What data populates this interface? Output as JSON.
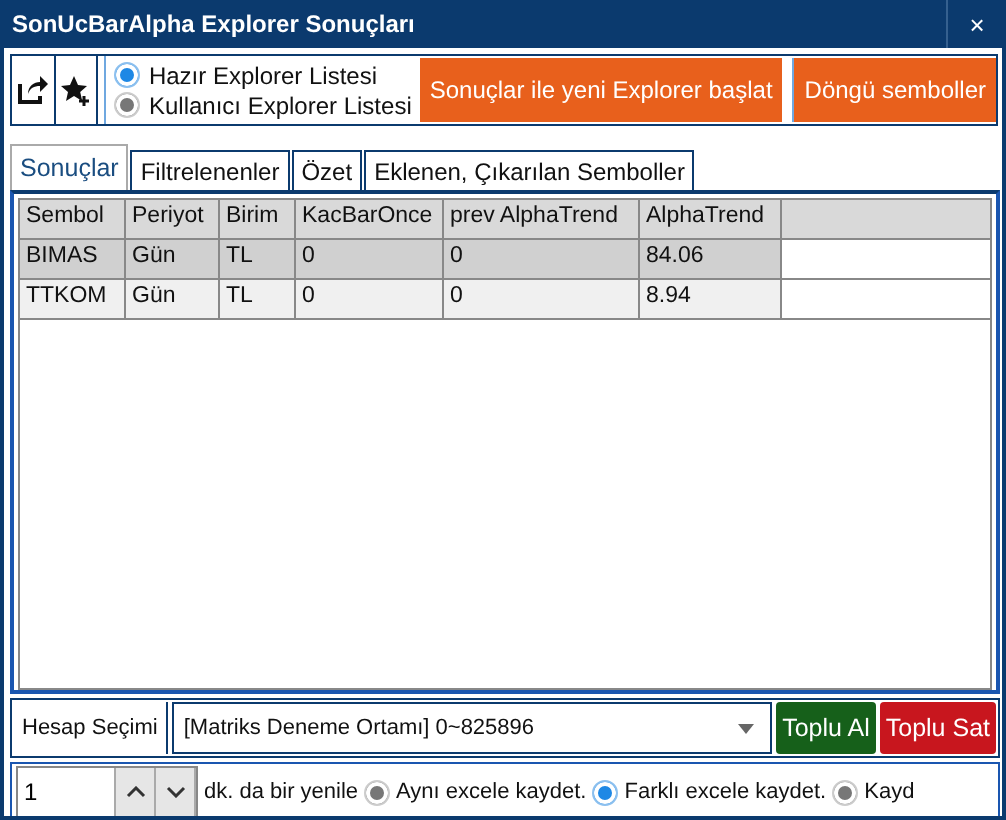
{
  "window": {
    "title": "SonUcBarAlpha Explorer Sonuçları",
    "close": "×"
  },
  "toolbar": {
    "list_options": [
      {
        "label": "Hazır Explorer Listesi",
        "selected": true
      },
      {
        "label": "Kullanıcı Explorer Listesi",
        "selected": false
      }
    ],
    "buttons": [
      "Sonuçlar ile yeni Explorer başlat",
      "Döngü semboller"
    ]
  },
  "tabs": [
    {
      "label": "Sonuçlar",
      "selected": true
    },
    {
      "label": "Filtrelenenler",
      "selected": false
    },
    {
      "label": "Özet",
      "selected": false
    },
    {
      "label": "Eklenen, Çıkarılan Semboller",
      "selected": false
    }
  ],
  "table": {
    "columns": [
      "Sembol",
      "Periyot",
      "Birim",
      "KacBarOnce",
      "prev AlphaTrend",
      "AlphaTrend"
    ],
    "rows": [
      {
        "cells": [
          "BIMAS",
          "Gün",
          "TL",
          "0",
          "0",
          "84.06"
        ],
        "selected": true
      },
      {
        "cells": [
          "TTKOM",
          "Gün",
          "TL",
          "0",
          "0",
          "8.94"
        ],
        "selected": false
      }
    ]
  },
  "account": {
    "label": "Hesap Seçimi",
    "value": "[Matriks Deneme Ortamı] 0~825896",
    "buy": "Toplu Al",
    "sell": "Toplu Sat"
  },
  "refresh": {
    "value": "1",
    "label": "dk. da bir yenile",
    "options": [
      {
        "label": "Aynı excele kaydet.",
        "selected": false
      },
      {
        "label": "Farklı excele kaydet.",
        "selected": true
      },
      {
        "label": "Kayd",
        "selected": false
      }
    ]
  }
}
